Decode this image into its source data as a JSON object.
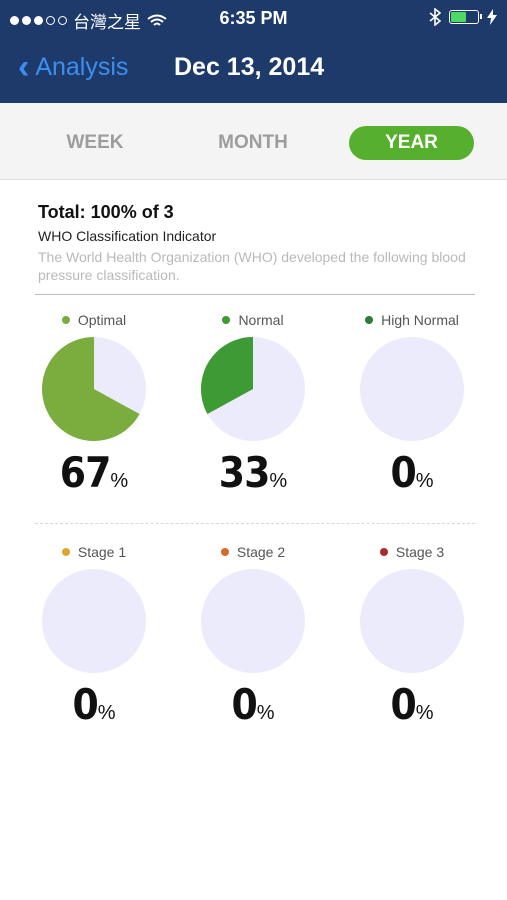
{
  "status_bar": {
    "carrier": "台灣之星",
    "time": "6:35 PM"
  },
  "nav": {
    "back_label": "Analysis",
    "title": "Dec 13, 2014"
  },
  "tabs": [
    {
      "label": "WEEK",
      "active": false
    },
    {
      "label": "MONTH",
      "active": false
    },
    {
      "label": "YEAR",
      "active": true
    }
  ],
  "summary": {
    "total": "Total: 100% of 3",
    "who_title": "WHO Classification Indicator",
    "who_desc": "The World Health Organization (WHO) developed the following blood pressure classification."
  },
  "categories": [
    {
      "label": "Optimal",
      "percent": 67,
      "dot_color": "#7aad3d",
      "slice_color": "#7aad3d"
    },
    {
      "label": "Normal",
      "percent": 33,
      "dot_color": "#3e9a34",
      "slice_color": "#3e9a34"
    },
    {
      "label": "High Normal",
      "percent": 0,
      "dot_color": "#2e7d32",
      "slice_color": "#2e7d32"
    },
    {
      "label": "Stage 1",
      "percent": 0,
      "dot_color": "#e0a52e",
      "slice_color": "#e0a52e"
    },
    {
      "label": "Stage 2",
      "percent": 0,
      "dot_color": "#d8682a",
      "slice_color": "#d8682a"
    },
    {
      "label": "Stage 3",
      "percent": 0,
      "dot_color": "#a82b2b",
      "slice_color": "#a82b2b"
    }
  ],
  "unit": "%",
  "colors": {
    "header_bg": "#1e3a6b",
    "accent": "#57b02d",
    "pie_bg": "#ebebfb"
  }
}
